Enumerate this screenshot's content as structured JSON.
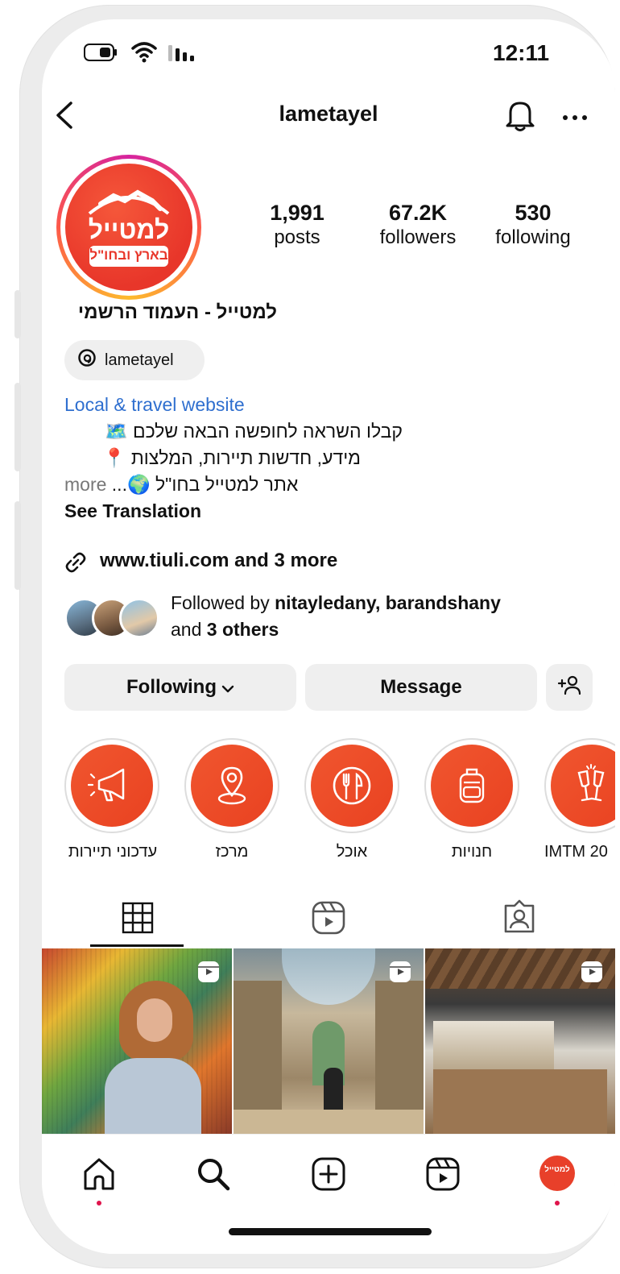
{
  "status_bar": {
    "time": "12:11"
  },
  "header": {
    "username": "lametayel"
  },
  "profile": {
    "avatar_text_top": "למטייל",
    "avatar_text_bottom": "בארץ ובחו\"ל",
    "stats": [
      {
        "value": "1,991",
        "label": "posts"
      },
      {
        "value": "67.2K",
        "label": "followers"
      },
      {
        "value": "530",
        "label": "following"
      }
    ],
    "full_name": "למטייל - העמוד הרשמי",
    "threads_handle": "lametayel",
    "bio": {
      "category": "Local & travel website",
      "line1": "קבלו השראה לחופשה הבאה שלכם 🗺️",
      "line2": "מידע, חדשות תיירות, המלצות 📍",
      "line3": "אתר למטייל בחו\"ל 🌍...",
      "more": "more",
      "see_translation": "See Translation"
    },
    "links": {
      "text": "www.tiuli.com and 3 more"
    },
    "followed_by": {
      "prefix": "Followed by ",
      "names": "nitayledany, barandshany",
      "and": "and ",
      "others": "3 others"
    }
  },
  "actions": {
    "following_label": "Following",
    "message_label": "Message"
  },
  "highlights": [
    {
      "label": "עדכוני תיירות",
      "icon": "megaphone-icon"
    },
    {
      "label": "מרכז",
      "icon": "map-pin-icon"
    },
    {
      "label": "אוכל",
      "icon": "utensils-icon"
    },
    {
      "label": "חנויות",
      "icon": "backpack-icon"
    },
    {
      "label": "IMTM 20",
      "icon": "champagne-icon"
    }
  ],
  "tabs": [
    "grid-icon",
    "reels-icon",
    "tagged-icon"
  ],
  "grid": [
    {
      "desc": "woman with curly hair eating in front of graffiti wall",
      "reel": true
    },
    {
      "desc": "woman standing in a grand shopping arcade",
      "reel": true
    },
    {
      "desc": "bakery counter interior",
      "reel": true
    }
  ],
  "bottom_nav": [
    "home-icon",
    "search-icon",
    "create-icon",
    "reels-icon",
    "profile-avatar"
  ],
  "colors": {
    "accent_orange": "#ee4a28",
    "link_blue": "#2f6fcf",
    "button_gray": "#efefef"
  }
}
